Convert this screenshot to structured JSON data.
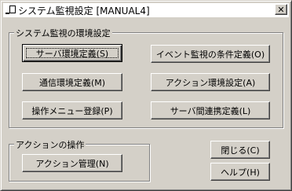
{
  "window": {
    "title": "システム監視設定 [MANUAL4]",
    "close_label": "✕"
  },
  "monitor_group": {
    "label": "システム監視の環境設定",
    "buttons": {
      "server_env": "サーバ環境定義(S)",
      "event_conditions": "イベント監視の条件定義(O)",
      "comm_env": "通信環境定義(M)",
      "action_env": "アクション環境設定(A)",
      "menu_register": "操作メニュー登録(P)",
      "server_link": "サーバ間連携定義(L)"
    }
  },
  "action_group": {
    "label": "アクションの操作",
    "buttons": {
      "action_manage": "アクション管理(N)"
    }
  },
  "footer": {
    "close": "閉じる(C)",
    "help": "ヘルプ(H)"
  }
}
